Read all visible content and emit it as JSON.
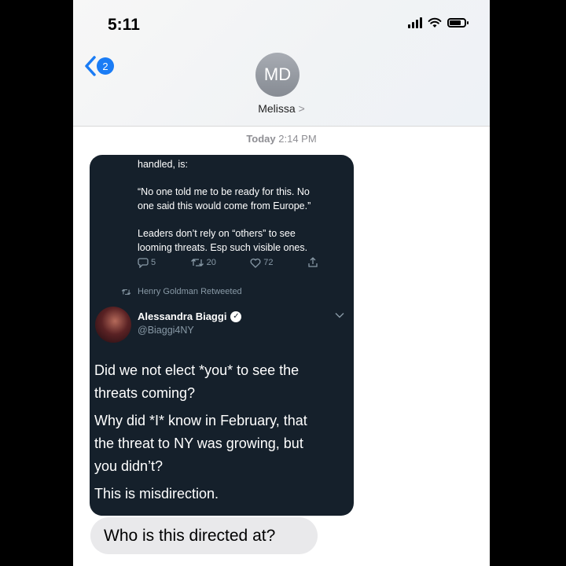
{
  "status_bar": {
    "time": "5:11"
  },
  "header": {
    "back_badge": "2",
    "avatar_initials": "MD",
    "contact_name": "Melissa",
    "contact_chevron": ">"
  },
  "timestamp": {
    "day": "Today",
    "time": "2:14 PM"
  },
  "screenshot": {
    "tweet1": {
      "lines": [
        "handled, is:",
        "“No one told me to be ready for this. No",
        "one said this would come from Europe.”",
        "Leaders don’t rely on “others” to see",
        "looming threats. Esp such visible ones."
      ],
      "replies": "5",
      "retweets": "20",
      "likes": "72"
    },
    "retweeted_by": "Henry Goldman Retweeted",
    "tweet2": {
      "author": "Alessandra Biaggi",
      "handle": "@Biaggi4NY",
      "lines": [
        "Did we not elect *you* to see the",
        "threats coming?",
        "Why did *I* know in February, that",
        "the threat to NY was growing, but",
        "you didn’t?",
        "This is misdirection."
      ]
    }
  },
  "reply_bubble": {
    "text": "Who is this directed at?"
  },
  "colors": {
    "accent": "#1a7cf5",
    "tweet_bg": "#15202b",
    "bubble_bg": "#e9e9eb"
  },
  "icons": [
    "signal-icon",
    "wifi-icon",
    "battery-icon",
    "back-chevron-icon",
    "reply-icon",
    "retweet-icon",
    "like-icon",
    "share-icon",
    "verified-icon",
    "caret-down-icon"
  ]
}
